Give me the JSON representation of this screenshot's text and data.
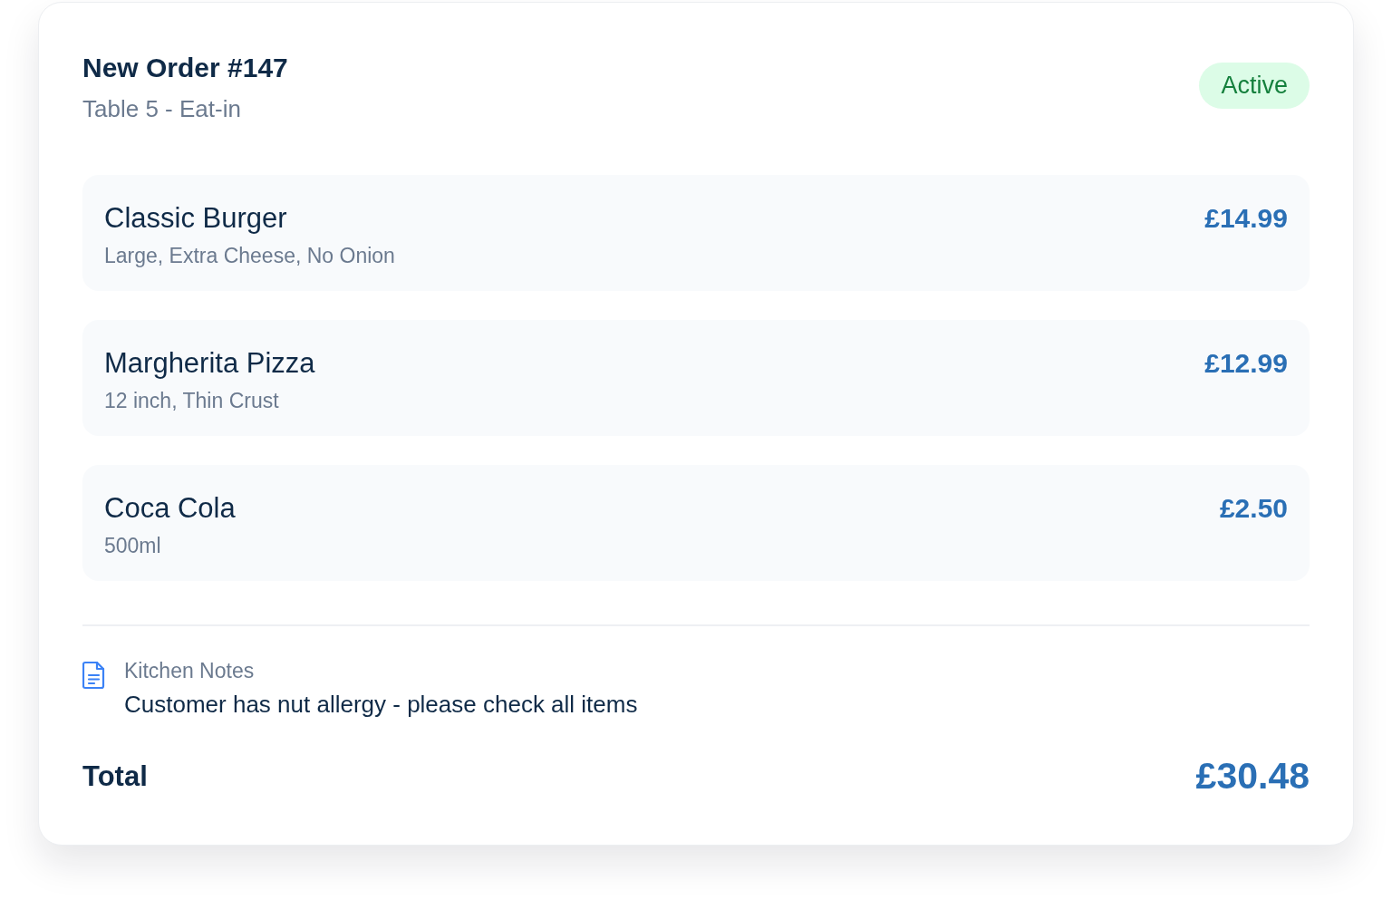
{
  "order": {
    "title": "New Order #147",
    "subtitle": "Table 5 - Eat-in",
    "status": "Active"
  },
  "items": [
    {
      "name": "Classic Burger",
      "details": "Large, Extra Cheese, No Onion",
      "price": "£14.99"
    },
    {
      "name": "Margherita Pizza",
      "details": "12 inch, Thin Crust",
      "price": "£12.99"
    },
    {
      "name": "Coca Cola",
      "details": "500ml",
      "price": "£2.50"
    }
  ],
  "notes": {
    "label": "Kitchen Notes",
    "text": "Customer has nut allergy - please check all items"
  },
  "total": {
    "label": "Total",
    "value": "£30.48"
  }
}
